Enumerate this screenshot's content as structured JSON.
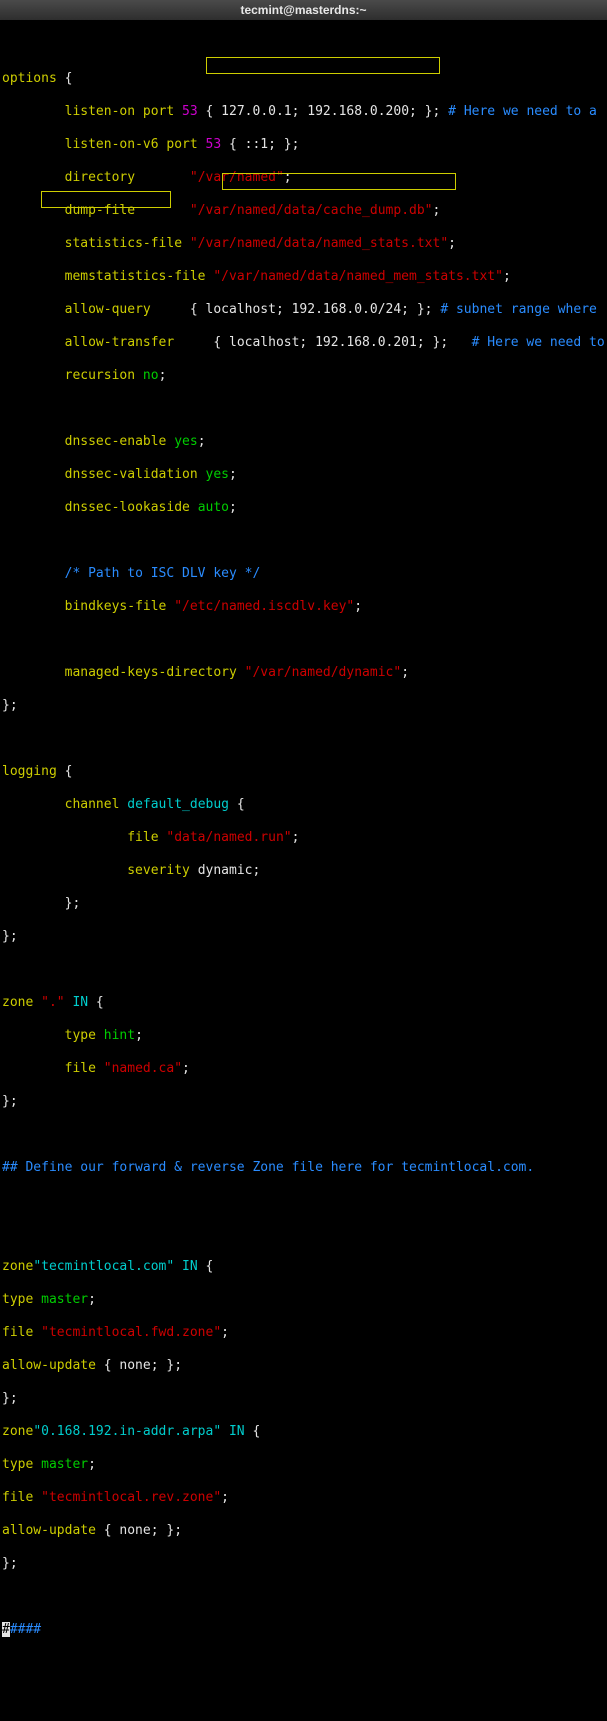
{
  "titlebar": "tecmint@masterdns:~",
  "cfg": {
    "options_kw": "options",
    "brace_open": "{",
    "brace_close": "}",
    "semicolon": ";",
    "listen_on_kw": "listen-on",
    "port_kw": "port",
    "port53": "53",
    "listen_on_ips": "{ 127.0.0.1; 192.168.0.200; };",
    "listen_comment": "# Here we need to a",
    "listen_on_v6_kw": "listen-on-v6",
    "v6_ips": "{ ::1; };",
    "directory_kw": "directory",
    "directory_val": "\"/var/named\"",
    "dump_file_kw": "dump-file",
    "dump_file_val": "\"/var/named/data/cache_dump.db\"",
    "stats_kw": "statistics-file",
    "stats_val": "\"/var/named/data/named_stats.txt\"",
    "memstats_kw": "memstatistics-file",
    "memstats_val": "\"/var/named/data/named_mem_stats.txt\"",
    "allow_query_kw": "allow-query",
    "allow_query_val": "{ localhost; 192.168.0.0/24; };",
    "allow_query_comment": "# subnet range where",
    "allow_transfer_kw": "allow-transfer",
    "allow_transfer_val": "{ localhost; 192.168.0.201; };",
    "allow_transfer_comment": "# Here we need to",
    "recursion_kw": "recursion",
    "recursion_val": "no",
    "dnssec_enable_kw": "dnssec-enable",
    "dnssec_validation_kw": "dnssec-validation",
    "dnssec_lookaside_kw": "dnssec-lookaside",
    "yes": "yes",
    "auto": "auto",
    "path_comment": "/* Path to ISC DLV key */",
    "bindkeys_kw": "bindkeys-file",
    "bindkeys_val": "\"/etc/named.iscdlv.key\"",
    "managed_kw": "managed-keys-directory",
    "managed_val": "\"/var/named/dynamic\"",
    "logging_kw": "logging",
    "channel_kw": "channel",
    "default_debug": "default_debug",
    "file_kw": "file",
    "data_named_run": "\"data/named.run\"",
    "severity_kw": "severity",
    "dynamic": "dynamic",
    "zone_kw": "zone",
    "dot": "\".\"",
    "IN": "IN",
    "type_kw": "type",
    "hint": "hint",
    "master": "master",
    "named_ca": "\"named.ca\"",
    "hash_comment": "## Define our forward & reverse Zone file here for tecmintlocal.com.",
    "zone1_name": "\"tecmintlocal.com\"",
    "fwd_zone": "\"tecmintlocal.fwd.zone\"",
    "allow_update_kw": "allow-update",
    "none_block": "{ none; };",
    "zone2_name": "\"0.168.192.in-addr.arpa\"",
    "rev_zone": "\"tecmintlocal.rev.zone\"",
    "cursor": "#",
    "tail": "####"
  }
}
